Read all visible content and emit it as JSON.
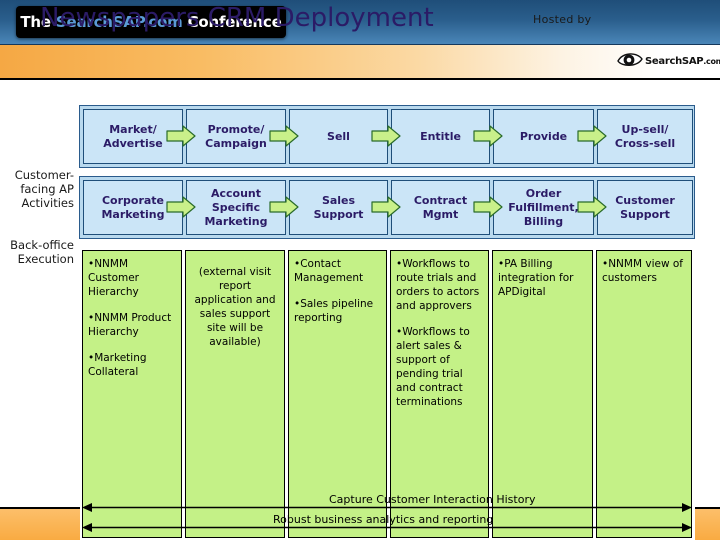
{
  "banner": {
    "conference_logo": {
      "prefix": "The ",
      "brand": "SearchSAP.com",
      "suffix": " Conference"
    }
  },
  "title_bar": {
    "title": "Newspapers CRM Deployment",
    "hosted_by": "Hosted by",
    "sponsor_logo_text": "SearchSAP",
    "sponsor_logo_tld": ".com",
    "eye_icon": "eye-logo-icon"
  },
  "diagram": {
    "row_labels": {
      "customer_facing": "Customer-\nfacing AP\nActivities",
      "customer_facing_lines": [
        "Customer-",
        "facing AP",
        "Activities"
      ],
      "back_office": "Back-office\nExecution",
      "back_office_lines": [
        "Back-office",
        "Execution"
      ]
    },
    "row_customer_facing": [
      {
        "label": "Market/\nAdvertise",
        "lines": [
          "Market/",
          "Advertise"
        ]
      },
      {
        "label": "Promote/\nCampaign",
        "lines": [
          "Promote/",
          "Campaign"
        ]
      },
      {
        "label": "Sell",
        "lines": [
          "Sell"
        ]
      },
      {
        "label": "Entitle",
        "lines": [
          "Entitle"
        ]
      },
      {
        "label": "Provide",
        "lines": [
          "Provide"
        ]
      },
      {
        "label": "Up-sell/\nCross-sell",
        "lines": [
          "Up-sell/",
          "Cross-sell"
        ]
      }
    ],
    "row_back_office": [
      {
        "label": "Corporate\nMarketing",
        "lines": [
          "Corporate",
          "Marketing"
        ]
      },
      {
        "label": "Account\nSpecific\nMarketing",
        "lines": [
          "Account",
          "Specific",
          "Marketing"
        ]
      },
      {
        "label": "Sales\nSupport",
        "lines": [
          "Sales",
          "Support"
        ]
      },
      {
        "label": "Contract\nMgmt",
        "lines": [
          "Contract",
          "Mgmt"
        ]
      },
      {
        "label": "Order\nFulfillment,\nBilling",
        "lines": [
          "Order",
          "Fulfillment,",
          "Billing"
        ]
      },
      {
        "label": "Customer\nSupport",
        "lines": [
          "Customer",
          "Support"
        ]
      }
    ],
    "detail_columns": [
      {
        "centered": false,
        "items": [
          "•NNMM Customer Hierarchy",
          "•NNMM Product Hierarchy",
          "•Marketing Collateral"
        ]
      },
      {
        "centered": true,
        "items": [
          "(external visit report application and sales support site will be available)"
        ]
      },
      {
        "centered": false,
        "items": [
          "•Contact Management",
          "•Sales pipeline reporting"
        ]
      },
      {
        "centered": false,
        "items": [
          "•Workflows to route trials and orders to actors and approvers",
          "•Workflows to alert sales & support of pending trial and contract terminations"
        ]
      },
      {
        "centered": false,
        "items": [
          "•PA Billing integration for APDigital"
        ]
      },
      {
        "centered": false,
        "items": [
          "•NNMM view of customers"
        ]
      }
    ],
    "bottom_arrows": [
      "Capture Customer Interaction History",
      "Robust business analytics and reporting"
    ]
  },
  "colors": {
    "banner_blue": "#1f4e79",
    "title_orange": "#f5a844",
    "blue_band": "#b9d9ee",
    "blue_cell": "#cbe5f7",
    "blue_cell_border": "#1f4e79",
    "title_text": "#2b1b66",
    "green_box": "#c4f187",
    "green_arrow": "#c9f08a",
    "green_arrow_border": "#2a6b2a",
    "orange_strip": "#f9ab42"
  }
}
